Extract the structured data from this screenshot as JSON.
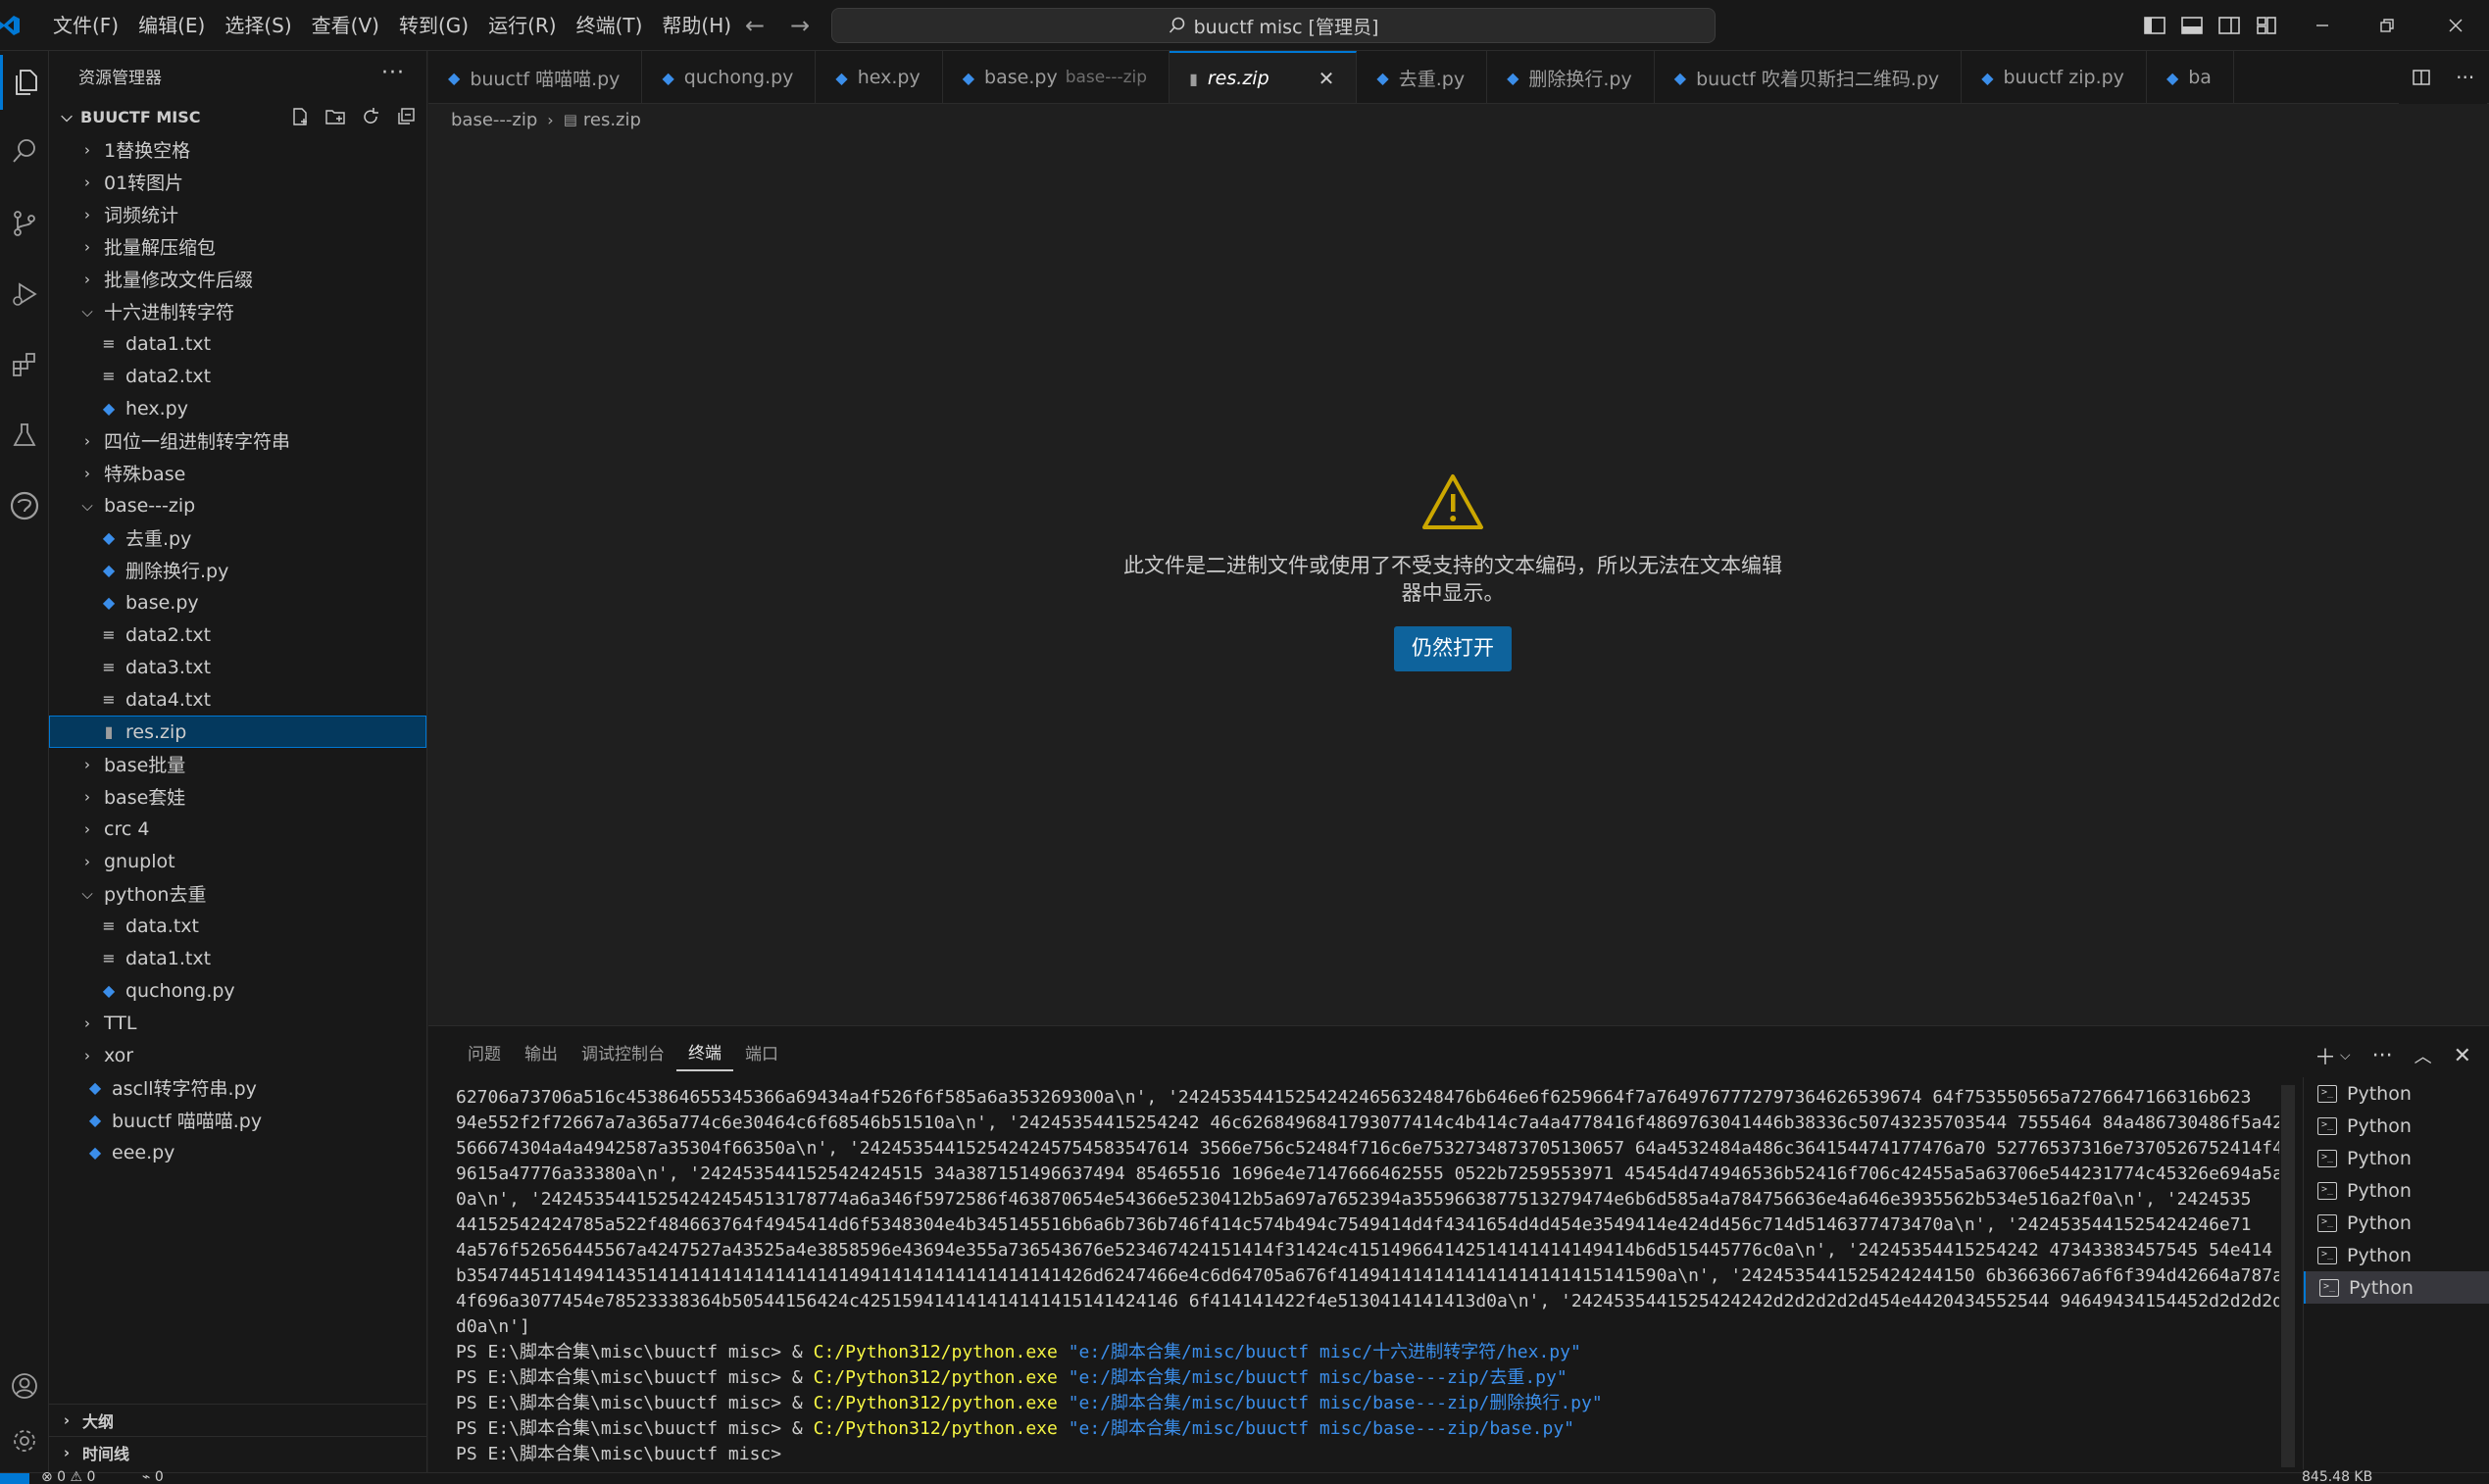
{
  "titlebar": {
    "menu": [
      "文件(F)",
      "编辑(E)",
      "选择(S)",
      "查看(V)",
      "转到(G)",
      "运行(R)",
      "终端(T)",
      "帮助(H)"
    ],
    "search_text": "buuctf misc [管理员]"
  },
  "sidebar": {
    "title": "资源管理器",
    "section": "BUUCTF MISC",
    "items": [
      {
        "label": "1替换空格",
        "kind": "folder",
        "expanded": false,
        "depth": 0
      },
      {
        "label": "01转图片",
        "kind": "folder",
        "expanded": false,
        "depth": 0
      },
      {
        "label": "词频统计",
        "kind": "folder",
        "expanded": false,
        "depth": 0
      },
      {
        "label": "批量解压缩包",
        "kind": "folder",
        "expanded": false,
        "depth": 0
      },
      {
        "label": "批量修改文件后缀",
        "kind": "folder",
        "expanded": false,
        "depth": 0
      },
      {
        "label": "十六进制转字符",
        "kind": "folder",
        "expanded": true,
        "depth": 0
      },
      {
        "label": "data1.txt",
        "kind": "txt",
        "depth": 1
      },
      {
        "label": "data2.txt",
        "kind": "txt",
        "depth": 1
      },
      {
        "label": "hex.py",
        "kind": "py",
        "depth": 1
      },
      {
        "label": "四位一组进制转字符串",
        "kind": "folder",
        "expanded": false,
        "depth": 0
      },
      {
        "label": "特殊base",
        "kind": "folder",
        "expanded": false,
        "depth": 0
      },
      {
        "label": "base---zip",
        "kind": "folder",
        "expanded": true,
        "depth": 0
      },
      {
        "label": "去重.py",
        "kind": "py",
        "depth": 1
      },
      {
        "label": "删除换行.py",
        "kind": "py",
        "depth": 1
      },
      {
        "label": "base.py",
        "kind": "py",
        "depth": 1
      },
      {
        "label": "data2.txt",
        "kind": "txt",
        "depth": 1
      },
      {
        "label": "data3.txt",
        "kind": "txt",
        "depth": 1
      },
      {
        "label": "data4.txt",
        "kind": "txt",
        "depth": 1
      },
      {
        "label": "res.zip",
        "kind": "zip",
        "depth": 1,
        "selected": true
      },
      {
        "label": "base批量",
        "kind": "folder",
        "expanded": false,
        "depth": 0
      },
      {
        "label": "base套娃",
        "kind": "folder",
        "expanded": false,
        "depth": 0
      },
      {
        "label": "crc 4",
        "kind": "folder",
        "expanded": false,
        "depth": 0
      },
      {
        "label": "gnuplot",
        "kind": "folder",
        "expanded": false,
        "depth": 0
      },
      {
        "label": "python去重",
        "kind": "folder",
        "expanded": true,
        "depth": 0
      },
      {
        "label": "data.txt",
        "kind": "txt",
        "depth": 1
      },
      {
        "label": "data1.txt",
        "kind": "txt",
        "depth": 1
      },
      {
        "label": "quchong.py",
        "kind": "py",
        "depth": 1
      },
      {
        "label": "TTL",
        "kind": "folder",
        "expanded": false,
        "depth": 0
      },
      {
        "label": "xor",
        "kind": "folder",
        "expanded": false,
        "depth": 0
      },
      {
        "label": "ascll转字符串.py",
        "kind": "py",
        "depth": 0
      },
      {
        "label": "buuctf 喵喵喵.py",
        "kind": "py",
        "depth": 0
      },
      {
        "label": "eee.py",
        "kind": "py",
        "depth": 0
      }
    ],
    "outline_label": "大纲",
    "timeline_label": "时间线"
  },
  "tabs": [
    {
      "label": "buuctf 喵喵喵.py",
      "kind": "py"
    },
    {
      "label": "quchong.py",
      "kind": "py"
    },
    {
      "label": "hex.py",
      "kind": "py"
    },
    {
      "label": "base.py",
      "kind": "py",
      "desc": "base---zip"
    },
    {
      "label": "res.zip",
      "kind": "zip",
      "active": true
    },
    {
      "label": "去重.py",
      "kind": "py"
    },
    {
      "label": "删除换行.py",
      "kind": "py"
    },
    {
      "label": "buuctf 吹着贝斯扫二维码.py",
      "kind": "py"
    },
    {
      "label": "buuctf zip.py",
      "kind": "py"
    },
    {
      "label": "ba",
      "kind": "py"
    }
  ],
  "breadcrumb": {
    "folder": "base---zip",
    "file": "res.zip"
  },
  "editor": {
    "message": "此文件是二进制文件或使用了不受支持的文本编码，所以无法在文本编辑器中显示。",
    "open_anyway": "仍然打开"
  },
  "panel": {
    "tabs": [
      "问题",
      "输出",
      "调试控制台",
      "终端",
      "端口"
    ],
    "active_tab": "终端",
    "terminal_lines": [
      "62706a73706a516c453864655345366a69434a4f526f6f585a6a353269300a\\n', '2424535441525424246563248476b646e6f6259664f7a7649767772797364626539674 64f753550565a7276647166316b623",
      "94e552f2f72667a7a365a774c6e30464c6f68546b51510a\\n', '24245354415254242 46c6268496841793077414c4b414c7a4a4778416f4869763041446b38336c50743235703544 7555464 84a486730486f5a42",
      "566674304a4a4942587a35304f66350a\\n', '2424535441525424245754583547614 3566e756c52484f716c6e7532734873705130657 64a4532484a486c364154474177476a70 52776537316e7370526752414f4",
      "9615a47776a33380a\\n', '242453544152542424515 34a387151496637494 85465516 1696e4e7147666462555 0522b7259553971 45454d474946536b52416f706c42455a5a63706e544231774c45326e694a5a45",
      "0a\\n', '24245354415254242454513178774a6a346f5972586f463870654e54366e5230412b5a697a7652394a3559663877513279474e6b6d585a4a784756636e4a646e3935562b534e516a2f0a\\n', '2424535",
      "44152542424785a522f484663764f4945414d6f5348304e4b345145516b6a6b736b746f414c574b494c7549414d4f4341654d4d454e3549414e424d456c714d5146377473470a\\n', '2424535441525424246e71",
      "4a576f52656445567a4247527a43525a4e3858596e43694e355a736543676e523467424151414f31424c415149664142514141414149414b6d515445776c0a\\n', '24245354415254242 47343383457545 54e414",
      "b35474451414941435141414141414141414149414141414141414141426d6247466e4c6d64705a676f4149414141414141414141415141590a\\n', '2424535441525424244150 6b3663667a6f6f394d42664a787a2f",
      "4f696a3077454e78523338364b50544156424c425159414141414141415141424146 6f414141422f4e5130414141413d0a\\n', '2424535441525424242d2d2d2d2d454e4420434552544 94649434154452d2d2d2d2d",
      "d0a\\n']",
      {
        "prompt": "PS E:\\脚本合集\\misc\\buuctf misc> & ",
        "exe": "C:/Python312/python.exe",
        "path": "\"e:/脚本合集/misc/buuctf misc/十六进制转字符/hex.py\""
      },
      {
        "prompt": "PS E:\\脚本合集\\misc\\buuctf misc> & ",
        "exe": "C:/Python312/python.exe",
        "path": "\"e:/脚本合集/misc/buuctf misc/base---zip/去重.py\""
      },
      {
        "prompt": "PS E:\\脚本合集\\misc\\buuctf misc> & ",
        "exe": "C:/Python312/python.exe",
        "path": "\"e:/脚本合集/misc/buuctf misc/base---zip/删除换行.py\""
      },
      {
        "prompt": "PS E:\\脚本合集\\misc\\buuctf misc> & ",
        "exe": "C:/Python312/python.exe",
        "path": "\"e:/脚本合集/misc/buuctf misc/base---zip/base.py\""
      },
      "PS E:\\脚本合集\\misc\\buuctf misc> "
    ],
    "terminal_instances": [
      "Python",
      "Python",
      "Python",
      "Python",
      "Python",
      "Python",
      "Python"
    ],
    "active_instance": 6
  },
  "statusbar": {
    "problems": "⊗ 0 ⚠ 0",
    "ports": "⌁ 0",
    "size": "845.48 KB"
  },
  "colors": {
    "accent": "#0078d4",
    "button": "#0e639c",
    "warning": "#cca700",
    "python": "#3b8eea",
    "exe": "#f5f543"
  }
}
